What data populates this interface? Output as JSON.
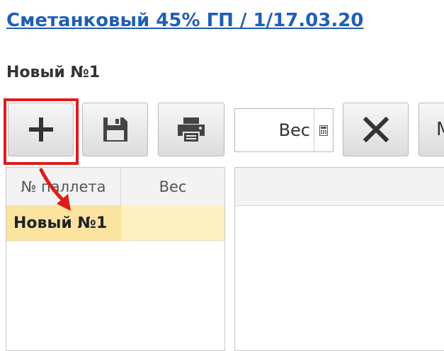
{
  "document": {
    "title_link": "Сметанковый 45% ГП / 1/17.03.20",
    "subtitle": "Новый №1"
  },
  "toolbar": {
    "add_icon": "plus-icon",
    "save_icon": "floppy-disk-icon",
    "print_icon": "printer-icon",
    "weight_placeholder": "Вес",
    "weight_calc_icon": "calculator-icon",
    "delete_icon": "x-icon",
    "cut_button_text": "М"
  },
  "pallet_grid": {
    "columns": [
      "№ паллета",
      "Вес"
    ],
    "rows": [
      {
        "number": "Новый №1",
        "weight": ""
      }
    ]
  },
  "colors": {
    "link": "#1f5fb4",
    "selected_row": "#fdf1c2",
    "selected_cell": "#fbe3a0",
    "highlight": "#e01b1b"
  }
}
